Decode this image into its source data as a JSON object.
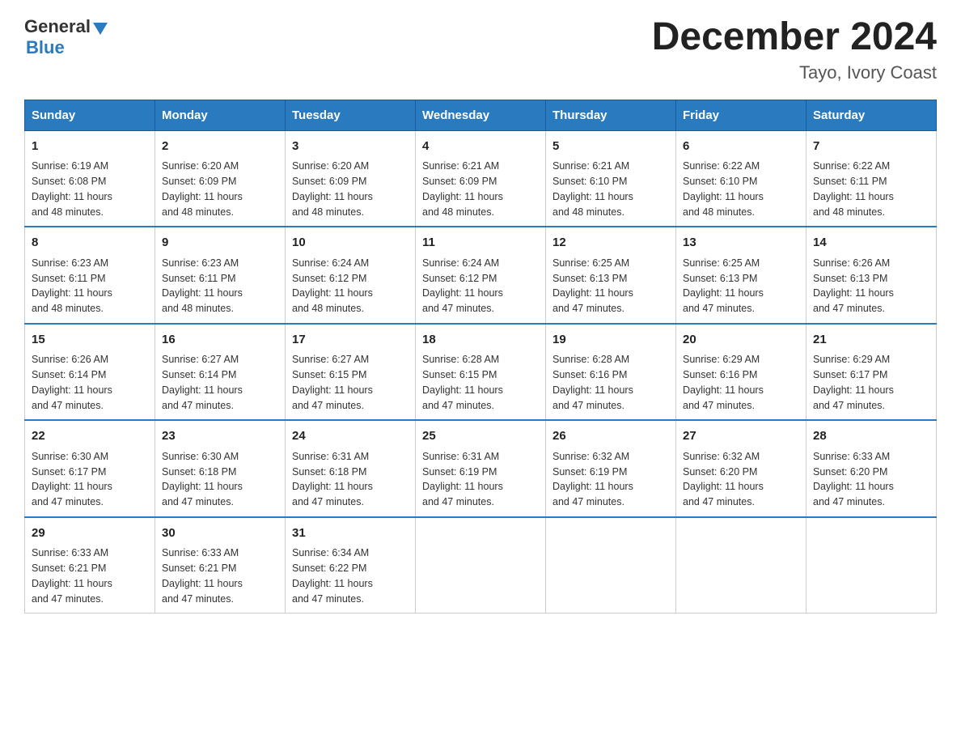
{
  "logo": {
    "general": "General",
    "blue": "Blue"
  },
  "title": "December 2024",
  "subtitle": "Tayo, Ivory Coast",
  "days": [
    "Sunday",
    "Monday",
    "Tuesday",
    "Wednesday",
    "Thursday",
    "Friday",
    "Saturday"
  ],
  "weeks": [
    [
      {
        "day": "1",
        "sunrise": "6:19 AM",
        "sunset": "6:08 PM",
        "daylight": "11 hours and 48 minutes."
      },
      {
        "day": "2",
        "sunrise": "6:20 AM",
        "sunset": "6:09 PM",
        "daylight": "11 hours and 48 minutes."
      },
      {
        "day": "3",
        "sunrise": "6:20 AM",
        "sunset": "6:09 PM",
        "daylight": "11 hours and 48 minutes."
      },
      {
        "day": "4",
        "sunrise": "6:21 AM",
        "sunset": "6:09 PM",
        "daylight": "11 hours and 48 minutes."
      },
      {
        "day": "5",
        "sunrise": "6:21 AM",
        "sunset": "6:10 PM",
        "daylight": "11 hours and 48 minutes."
      },
      {
        "day": "6",
        "sunrise": "6:22 AM",
        "sunset": "6:10 PM",
        "daylight": "11 hours and 48 minutes."
      },
      {
        "day": "7",
        "sunrise": "6:22 AM",
        "sunset": "6:11 PM",
        "daylight": "11 hours and 48 minutes."
      }
    ],
    [
      {
        "day": "8",
        "sunrise": "6:23 AM",
        "sunset": "6:11 PM",
        "daylight": "11 hours and 48 minutes."
      },
      {
        "day": "9",
        "sunrise": "6:23 AM",
        "sunset": "6:11 PM",
        "daylight": "11 hours and 48 minutes."
      },
      {
        "day": "10",
        "sunrise": "6:24 AM",
        "sunset": "6:12 PM",
        "daylight": "11 hours and 48 minutes."
      },
      {
        "day": "11",
        "sunrise": "6:24 AM",
        "sunset": "6:12 PM",
        "daylight": "11 hours and 47 minutes."
      },
      {
        "day": "12",
        "sunrise": "6:25 AM",
        "sunset": "6:13 PM",
        "daylight": "11 hours and 47 minutes."
      },
      {
        "day": "13",
        "sunrise": "6:25 AM",
        "sunset": "6:13 PM",
        "daylight": "11 hours and 47 minutes."
      },
      {
        "day": "14",
        "sunrise": "6:26 AM",
        "sunset": "6:13 PM",
        "daylight": "11 hours and 47 minutes."
      }
    ],
    [
      {
        "day": "15",
        "sunrise": "6:26 AM",
        "sunset": "6:14 PM",
        "daylight": "11 hours and 47 minutes."
      },
      {
        "day": "16",
        "sunrise": "6:27 AM",
        "sunset": "6:14 PM",
        "daylight": "11 hours and 47 minutes."
      },
      {
        "day": "17",
        "sunrise": "6:27 AM",
        "sunset": "6:15 PM",
        "daylight": "11 hours and 47 minutes."
      },
      {
        "day": "18",
        "sunrise": "6:28 AM",
        "sunset": "6:15 PM",
        "daylight": "11 hours and 47 minutes."
      },
      {
        "day": "19",
        "sunrise": "6:28 AM",
        "sunset": "6:16 PM",
        "daylight": "11 hours and 47 minutes."
      },
      {
        "day": "20",
        "sunrise": "6:29 AM",
        "sunset": "6:16 PM",
        "daylight": "11 hours and 47 minutes."
      },
      {
        "day": "21",
        "sunrise": "6:29 AM",
        "sunset": "6:17 PM",
        "daylight": "11 hours and 47 minutes."
      }
    ],
    [
      {
        "day": "22",
        "sunrise": "6:30 AM",
        "sunset": "6:17 PM",
        "daylight": "11 hours and 47 minutes."
      },
      {
        "day": "23",
        "sunrise": "6:30 AM",
        "sunset": "6:18 PM",
        "daylight": "11 hours and 47 minutes."
      },
      {
        "day": "24",
        "sunrise": "6:31 AM",
        "sunset": "6:18 PM",
        "daylight": "11 hours and 47 minutes."
      },
      {
        "day": "25",
        "sunrise": "6:31 AM",
        "sunset": "6:19 PM",
        "daylight": "11 hours and 47 minutes."
      },
      {
        "day": "26",
        "sunrise": "6:32 AM",
        "sunset": "6:19 PM",
        "daylight": "11 hours and 47 minutes."
      },
      {
        "day": "27",
        "sunrise": "6:32 AM",
        "sunset": "6:20 PM",
        "daylight": "11 hours and 47 minutes."
      },
      {
        "day": "28",
        "sunrise": "6:33 AM",
        "sunset": "6:20 PM",
        "daylight": "11 hours and 47 minutes."
      }
    ],
    [
      {
        "day": "29",
        "sunrise": "6:33 AM",
        "sunset": "6:21 PM",
        "daylight": "11 hours and 47 minutes."
      },
      {
        "day": "30",
        "sunrise": "6:33 AM",
        "sunset": "6:21 PM",
        "daylight": "11 hours and 47 minutes."
      },
      {
        "day": "31",
        "sunrise": "6:34 AM",
        "sunset": "6:22 PM",
        "daylight": "11 hours and 47 minutes."
      },
      null,
      null,
      null,
      null
    ]
  ],
  "labels": {
    "sunrise": "Sunrise:",
    "sunset": "Sunset:",
    "daylight": "Daylight:"
  }
}
